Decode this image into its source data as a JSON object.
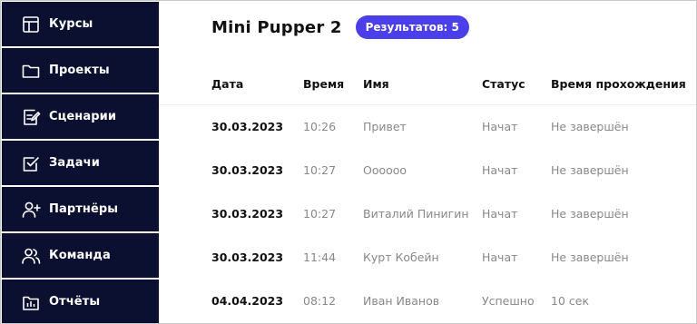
{
  "sidebar": {
    "items": [
      {
        "label": "Курсы",
        "icon": "layout-icon"
      },
      {
        "label": "Проекты",
        "icon": "folder-icon"
      },
      {
        "label": "Сценарии",
        "icon": "edit-document-icon"
      },
      {
        "label": "Задачи",
        "icon": "checkbox-icon"
      },
      {
        "label": "Партнёры",
        "icon": "add-user-icon"
      },
      {
        "label": "Команда",
        "icon": "team-icon"
      },
      {
        "label": "Отчёты",
        "icon": "report-chart-icon"
      }
    ],
    "colors": {
      "background": "#0c1030",
      "text": "#ffffff"
    }
  },
  "header": {
    "title": "Mini Pupper 2",
    "badge": "Результатов: 5",
    "badge_color": "#4a3fe8"
  },
  "table": {
    "columns": [
      "Дата",
      "Время",
      "Имя",
      "Статус",
      "Время прохождения"
    ],
    "rows": [
      [
        "30.03.2023",
        "10:26",
        "Привет",
        "Начат",
        "Не завершён"
      ],
      [
        "30.03.2023",
        "10:27",
        "Оооооо",
        "Начат",
        "Не завершён"
      ],
      [
        "30.03.2023",
        "10:27",
        "Виталий Пинигин",
        "Начат",
        "Не завершён"
      ],
      [
        "30.03.2023",
        "11:44",
        "Курт Кобейн",
        "Начат",
        "Не завершён"
      ],
      [
        "04.04.2023",
        "08:12",
        "Иван Иванов",
        "Успешно",
        "10 сек"
      ]
    ]
  }
}
